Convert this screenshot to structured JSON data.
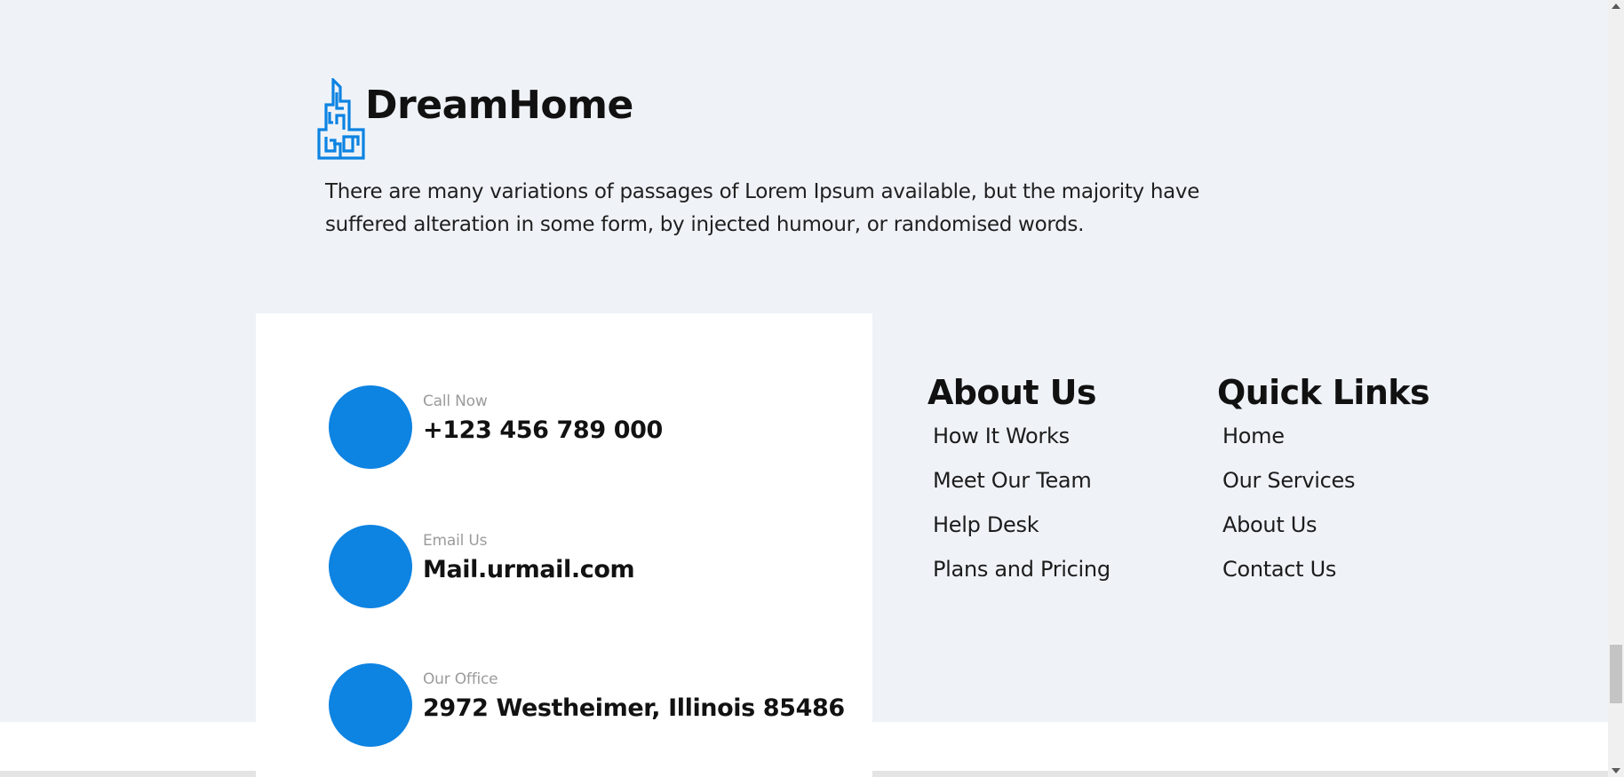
{
  "brand": {
    "name": "DreamHome",
    "description": "There are many variations of passages of Lorem Ipsum available, but the majority have suffered alteration in some form, by injected humour, or randomised words.",
    "logo_icon": "building-icon"
  },
  "contact": {
    "items": [
      {
        "label": "Call Now",
        "value": "+123 456 789 000"
      },
      {
        "label": "Email Us",
        "value": "Mail.urmail.com"
      },
      {
        "label": "Our Office",
        "value": "2972 Westheimer, Illinois 85486"
      }
    ]
  },
  "about": {
    "heading": "About Us",
    "links": [
      "How It Works",
      "Meet Our Team",
      "Help Desk",
      "Plans and Pricing"
    ]
  },
  "quick_links": {
    "heading": "Quick Links",
    "links": [
      "Home",
      "Our Services",
      "About Us",
      "Contact Us"
    ]
  },
  "colors": {
    "accent": "#0d83e2",
    "background": "#eff3f8",
    "card": "#ffffff"
  }
}
